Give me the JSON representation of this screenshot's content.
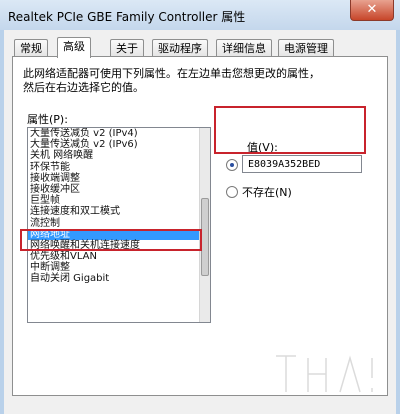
{
  "window": {
    "title": "Realtek PCIe GBE Family Controller 属性",
    "close_label": "✕"
  },
  "tabs": [
    "常规",
    "高级",
    "关于",
    "驱动程序",
    "详细信息",
    "电源管理"
  ],
  "active_tab": "高级",
  "description": [
    "此网络适配器可使用下列属性。在左边单击您想更改的属性，",
    "然后在右边选择它的值。"
  ],
  "property_label": "属性(P):",
  "properties": [
    "大量传送减负 v2 (IPv4)",
    "大量传送减负 v2 (IPv6)",
    "关机 网络唤醒",
    "环保节能",
    "接收端调整",
    "接收缓冲区",
    "巨型帧",
    "连接速度和双工模式",
    "流控制",
    "网络地址",
    "网络唤醒和关机连接速度",
    "优先级和VLAN",
    "中断调整",
    "自动关闭 Gigabit"
  ],
  "selected_property": "网络地址",
  "value_label": "值(V):",
  "value_input": "E8039A352BED",
  "not_present_label": "不存在(N)"
}
